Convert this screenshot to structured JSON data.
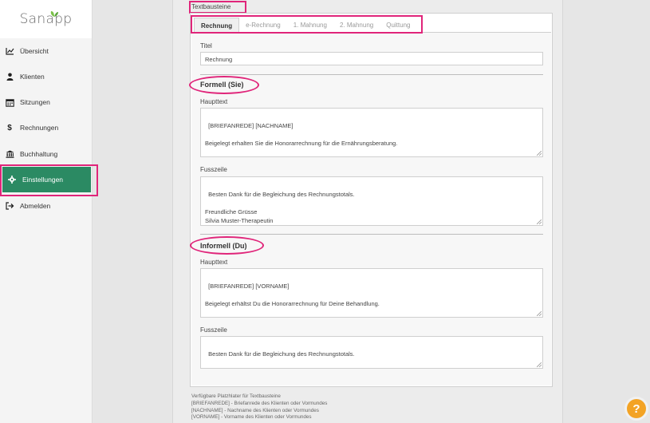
{
  "app": {
    "logo_text": "Sanapp"
  },
  "sidebar": {
    "items": [
      {
        "label": "Übersicht",
        "icon": "chart-line-icon"
      },
      {
        "label": "Klienten",
        "icon": "user-icon"
      },
      {
        "label": "Sitzungen",
        "icon": "calendar-icon"
      },
      {
        "label": "Rechnungen",
        "icon": "dollar-icon"
      },
      {
        "label": "Buchhaltung",
        "icon": "bank-icon"
      },
      {
        "label": "Einstellungen",
        "icon": "gear-icon",
        "active": true
      },
      {
        "label": "Abmelden",
        "icon": "sign-out-icon"
      }
    ]
  },
  "main": {
    "section_title": "Textbausteine",
    "tabs": [
      "Rechnung",
      "e-Rechnung",
      "1. Mahnung",
      "2. Mahnung",
      "Quittung"
    ],
    "active_tab": "Rechnung",
    "titel_label": "Titel",
    "titel_value": "Rechnung",
    "formell": {
      "heading": "Formell (Sie)",
      "haupttext_label": "Haupttext",
      "haupttext_value": "[BRIEFANREDE] [NACHNAME]\n\nBeigelegt erhalten Sie die Honorarrechnung für die Ernährungsberatung.",
      "fusszeile_label": "Fusszeile",
      "fusszeile_value": "Besten Dank für die Begleichung des Rechnungstotals.\n\nFreundliche Grüsse\nSilvia Muster-Therapeutin"
    },
    "informell": {
      "heading": "Informell (Du)",
      "haupttext_label": "Haupttext",
      "haupttext_value": "[BRIEFANREDE] [VORNAME]\n\nBeigelegt erhältst Du die Honorarrechnung für Deine Behandlung.",
      "fusszeile_label": "Fusszeile",
      "fusszeile_value": "Besten Dank für die Begleichung des Rechnungstotals."
    },
    "placeholders": {
      "title": "Verfügbare Platzhlater für Textbausteine",
      "lines": [
        "[BRIEFANREDE] - Briefanrede des Klienten oder Vormundes",
        "[NACHNAME] - Nachname des Klienten oder Vormundes",
        "[VORNAME] - Vorname des Klienten oder Vormundes"
      ]
    }
  },
  "help": {
    "label": "?"
  },
  "colors": {
    "accent": "#2b8a63",
    "highlight": "#e0257a",
    "help": "#f3a325"
  }
}
